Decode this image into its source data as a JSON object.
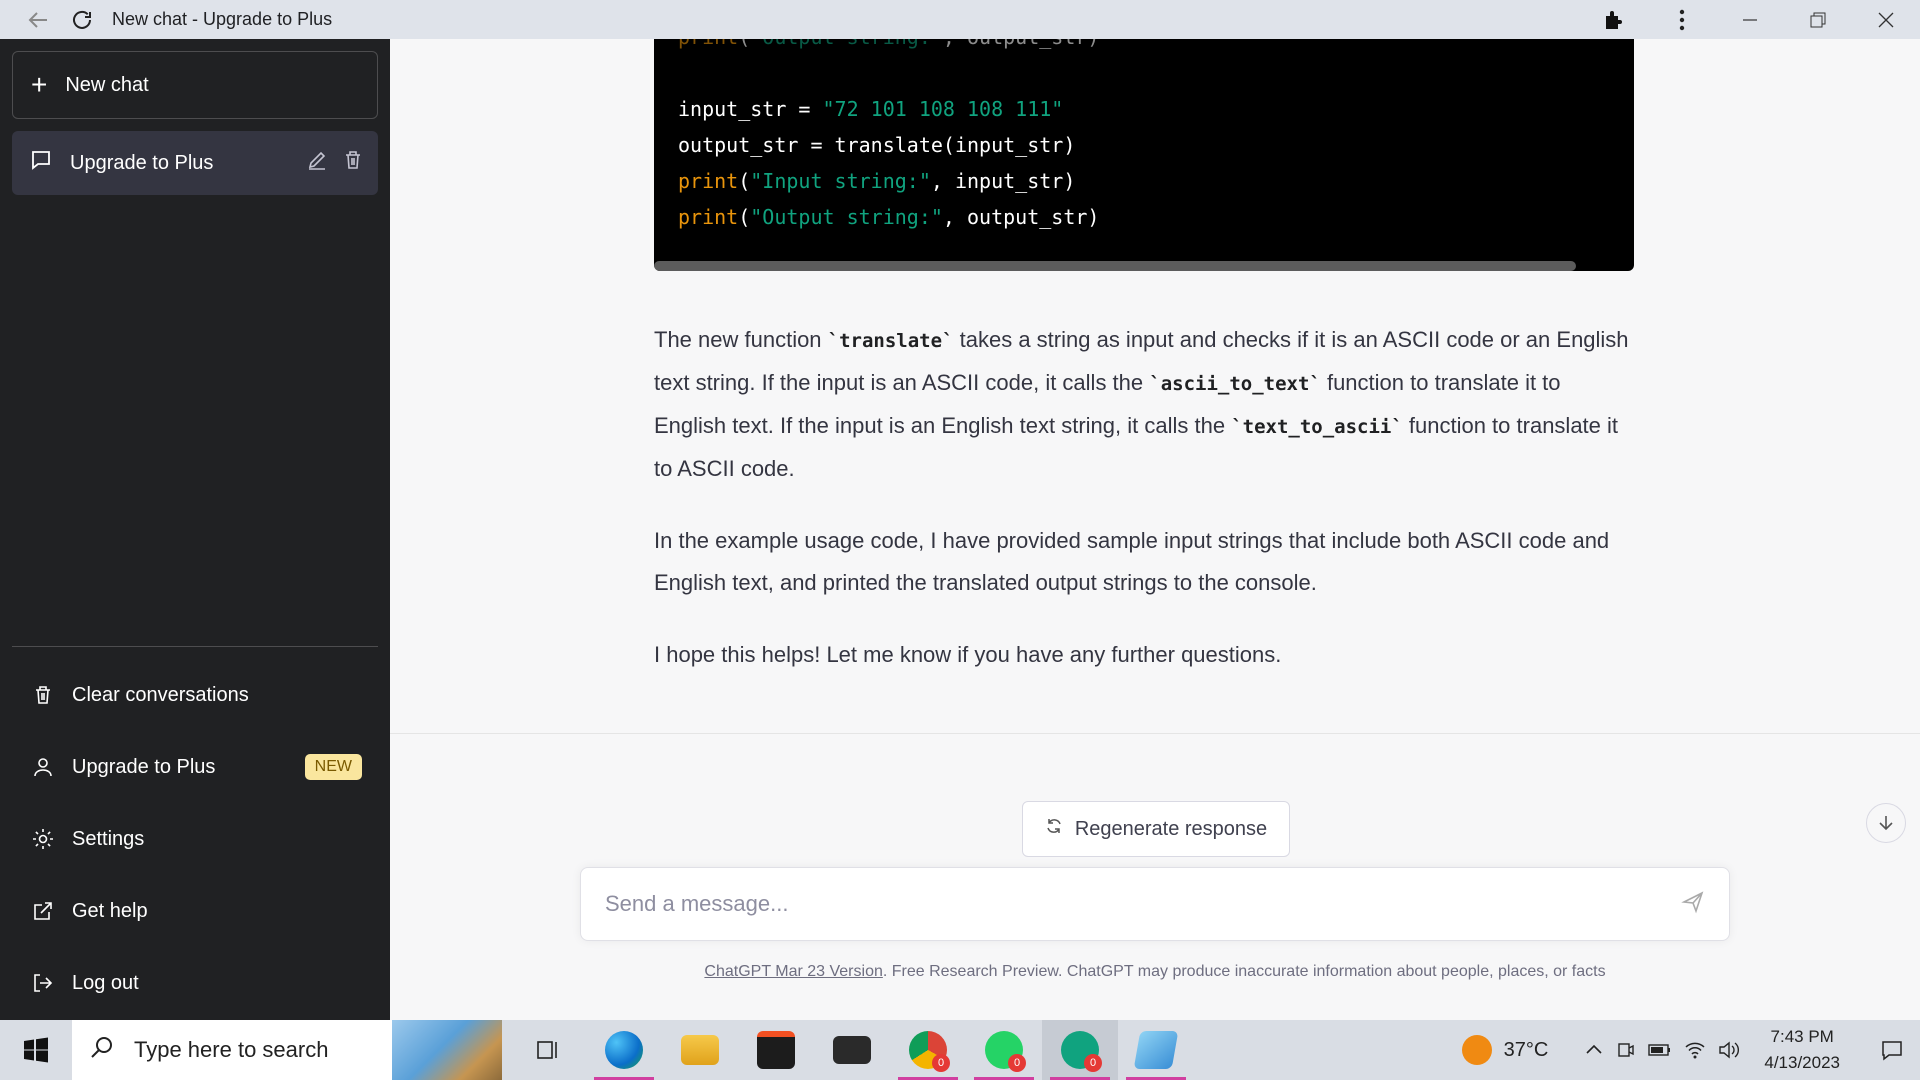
{
  "window": {
    "title": "New chat - Upgrade to Plus"
  },
  "sidebar": {
    "new_chat_label": "New chat",
    "conversations": [
      {
        "label": "Upgrade to Plus"
      }
    ],
    "menu": {
      "clear": "Clear conversations",
      "upgrade": "Upgrade to Plus",
      "upgrade_badge": "NEW",
      "settings": "Settings",
      "help": "Get help",
      "logout": "Log out"
    }
  },
  "code": {
    "lines": [
      {
        "kw": "print",
        "paren": "(",
        "str": "\"Output string:\"",
        "rest": ", output_str)"
      },
      {
        "plain": "input_str = ",
        "str": "\"72 101 108 108 111\""
      },
      {
        "plain": "output_str = translate(input_str)"
      },
      {
        "kw": "print",
        "paren": "(",
        "str": "\"Input string:\"",
        "rest": ", input_str)"
      },
      {
        "kw": "print",
        "paren": "(",
        "str": "\"Output string:\"",
        "rest": ", output_str)"
      }
    ]
  },
  "answer": {
    "p1": {
      "a": "The new function ",
      "code1": "`translate`",
      "b": " takes a string as input and checks if it is an ASCII code or an English text string. If the input is an ASCII code, it calls the ",
      "code2": "`ascii_to_text`",
      "c": " function to translate it to English text. If the input is an English text string, it calls the ",
      "code3": "`text_to_ascii`",
      "d": " function to translate it to ASCII code."
    },
    "p2": "In the example usage code, I have provided sample input strings that include both ASCII code and English text, and printed the translated output strings to the console.",
    "p3": "I hope this helps! Let me know if you have any further questions."
  },
  "regenerate_label": "Regenerate response",
  "input": {
    "placeholder": "Send a message..."
  },
  "footer": {
    "link": "ChatGPT Mar 23 Version",
    "text": ". Free Research Preview. ChatGPT may produce inaccurate information about people, places, or facts"
  },
  "taskbar": {
    "search_placeholder": "Type here to search",
    "temperature": "37°C",
    "time": "7:43 PM",
    "date": "4/13/2023",
    "badges": {
      "chrome": "0",
      "whatsapp": "0",
      "chatgpt": "0"
    }
  },
  "colors": {
    "sidebar_bg": "#202123",
    "accent_green": "#10a37f",
    "code_keyword": "#e9950c",
    "badge_bg": "#fae69e"
  }
}
